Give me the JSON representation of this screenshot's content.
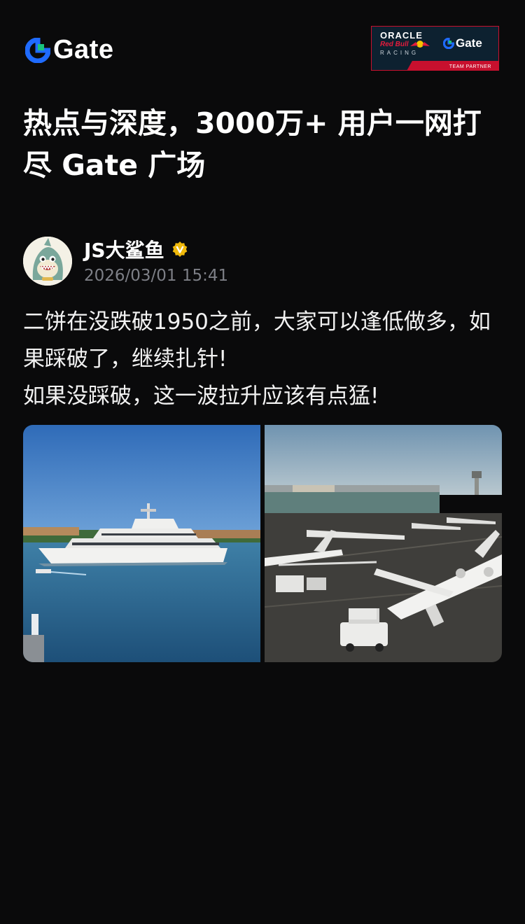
{
  "header": {
    "logo_text": "Gate",
    "partner": {
      "oracle": "ORACLE",
      "redbull": "Red Bull",
      "racing": "RACING",
      "gate": "Gate",
      "team_partner": "TEAM PARTNER"
    }
  },
  "headline": "热点与深度，3000万+ 用户一网打尽 Gate 广场",
  "post": {
    "author": "JS大鲨鱼",
    "timestamp": "2026/03/01 15:41",
    "text": "二饼在没跌破1950之前，大家可以逢低做多，如果踩破了，继续扎针!\n如果没踩破，这一波拉升应该有点猛!",
    "images": [
      "yacht-photo",
      "private-jets-airport-photo"
    ]
  },
  "colors": {
    "background": "#0a0a0b",
    "accent_blue": "#1f6bff",
    "accent_green": "#19c37d",
    "verified_gold": "#f0b90b",
    "timestamp": "#7d7f86"
  },
  "icons": [
    "gate-logo-icon",
    "verified-badge-icon",
    "redbull-icon",
    "avatar-shark"
  ]
}
